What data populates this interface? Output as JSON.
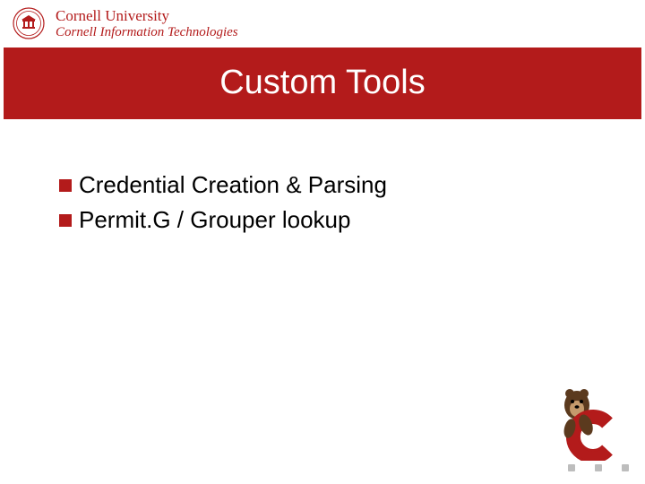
{
  "header": {
    "university": "Cornell University",
    "department": "Cornell Information Technologies"
  },
  "title": "Custom Tools",
  "bullets": [
    "Credential Creation & Parsing",
    "Permit.G / Grouper lookup"
  ]
}
